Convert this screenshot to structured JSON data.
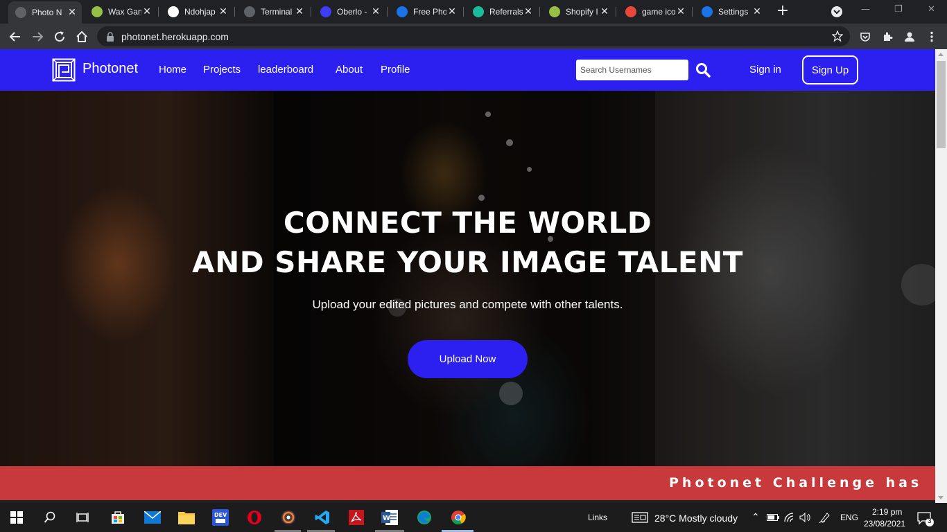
{
  "browser": {
    "tabs": [
      {
        "title": "Photo N",
        "favicon": "globe-icon",
        "color": "#5f6368",
        "active": true
      },
      {
        "title": "Wax Gan",
        "favicon": "shopify-icon",
        "color": "#95bf47",
        "active": false
      },
      {
        "title": "Ndohjap",
        "favicon": "github-icon",
        "color": "#ffffff",
        "active": false
      },
      {
        "title": "Terminal",
        "favicon": "globe-icon",
        "color": "#5f6368",
        "active": false
      },
      {
        "title": "Oberlo -",
        "favicon": "oberlo-icon",
        "color": "#3d3df5",
        "active": false
      },
      {
        "title": "Free Pho",
        "favicon": "pexels-icon",
        "color": "#1a73e8",
        "active": false
      },
      {
        "title": "Referrals",
        "favicon": "referrals-icon",
        "color": "#1abc9c",
        "active": false
      },
      {
        "title": "Shopify I",
        "favicon": "shopify-icon",
        "color": "#95bf47",
        "active": false
      },
      {
        "title": "game ico",
        "favicon": "game-icon",
        "color": "#e8483c",
        "active": false
      },
      {
        "title": "Settings",
        "favicon": "gear-icon",
        "color": "#1a73e8",
        "active": false
      }
    ],
    "new_tab_label": "+",
    "address": "photonet.herokuapp.com"
  },
  "site": {
    "brand": "Photonet",
    "nav": [
      "Home",
      "Projects",
      "leaderboard",
      "About",
      "Profile"
    ],
    "search_placeholder": "Search Usernames",
    "sign_in": "Sign in",
    "sign_up": "Sign Up",
    "accent_color": "#2c20f0"
  },
  "hero": {
    "headline_1": "CONNECT THE WORLD",
    "headline_2": "AND SHARE YOUR IMAGE TALENT",
    "subtext": "Upload your edited pictures and compete with other talents.",
    "cta": "Upload Now"
  },
  "banner": {
    "text": "Photonet Challenge has",
    "color": "#c8393b"
  },
  "taskbar": {
    "links_label": "Links",
    "weather": "28°C  Mostly cloudy",
    "language": "ENG",
    "time": "2:19 pm",
    "date": "23/08/2021",
    "notifications": "3"
  }
}
